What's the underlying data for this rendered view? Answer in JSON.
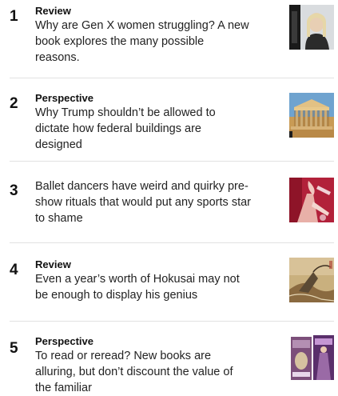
{
  "most_read": {
    "items": [
      {
        "rank": "1",
        "kicker": "Review",
        "headline": "Why are Gen X women struggling? A new book explores the many possible reasons.",
        "thumbnail_icon": "woman-portrait-photo"
      },
      {
        "rank": "2",
        "kicker": "Perspective",
        "headline": "Why Trump shouldn’t be allowed to dictate how federal buildings are designed",
        "thumbnail_icon": "supreme-court-building-photo"
      },
      {
        "rank": "3",
        "kicker": "",
        "headline": "Ballet dancers have weird and quirky pre-show rituals that would put any sports star to shame",
        "thumbnail_icon": "ballet-dancer-photo"
      },
      {
        "rank": "4",
        "kicker": "Review",
        "headline": "Even a year’s worth of Hokusai may not be enough to display his genius",
        "thumbnail_icon": "hokusai-painting-photo"
      },
      {
        "rank": "5",
        "kicker": "Perspective",
        "headline": "To read or reread? New books are alluring, but don’t discount the value of the familiar",
        "thumbnail_icon": "book-covers-photo"
      }
    ]
  }
}
